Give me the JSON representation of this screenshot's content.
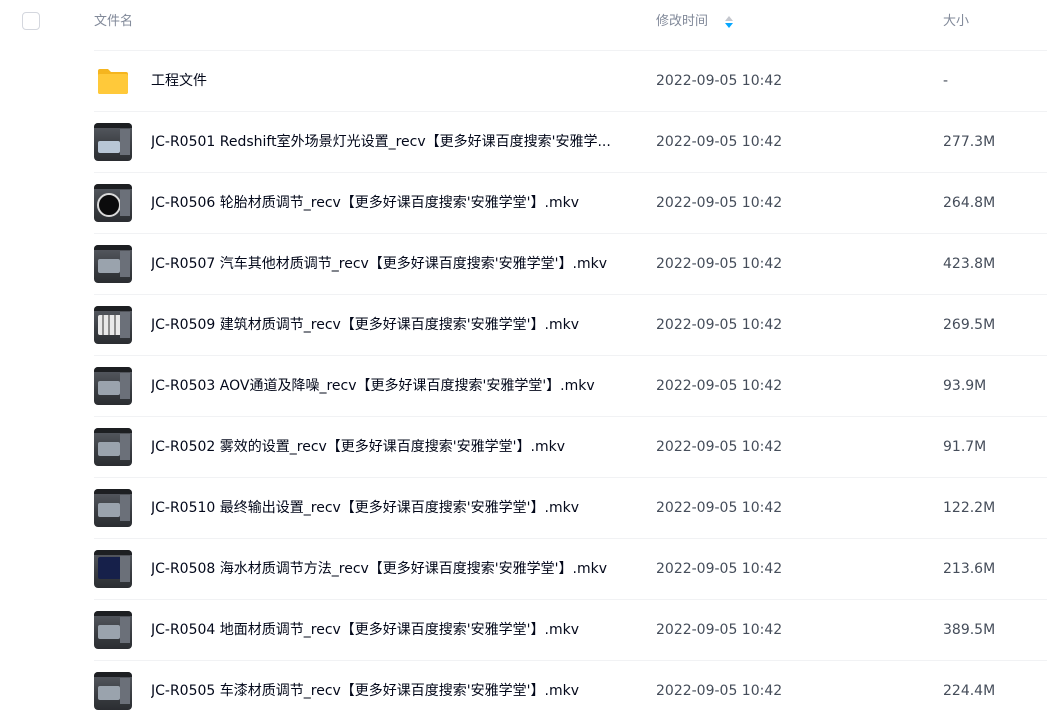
{
  "header": {
    "name_label": "文件名",
    "time_label": "修改时间",
    "size_label": "大小"
  },
  "files": [
    {
      "name": "工程文件",
      "modified": "2022-09-05 10:42",
      "size": "-",
      "icon": "folder-icon"
    },
    {
      "name": "JC-R0501 Redshift室外场景灯光设置_recv【更多好课百度搜索'安雅学...",
      "modified": "2022-09-05 10:42",
      "size": "277.3M",
      "icon": "video-thumbnail-icon"
    },
    {
      "name": "JC-R0506 轮胎材质调节_recv【更多好课百度搜索'安雅学堂'】.mkv",
      "modified": "2022-09-05 10:42",
      "size": "264.8M",
      "icon": "video-thumbnail-icon"
    },
    {
      "name": "JC-R0507 汽车其他材质调节_recv【更多好课百度搜索'安雅学堂'】.mkv",
      "modified": "2022-09-05 10:42",
      "size": "423.8M",
      "icon": "video-thumbnail-icon"
    },
    {
      "name": "JC-R0509 建筑材质调节_recv【更多好课百度搜索'安雅学堂'】.mkv",
      "modified": "2022-09-05 10:42",
      "size": "269.5M",
      "icon": "video-thumbnail-icon"
    },
    {
      "name": "JC-R0503 AOV通道及降噪_recv【更多好课百度搜索'安雅学堂'】.mkv",
      "modified": "2022-09-05 10:42",
      "size": "93.9M",
      "icon": "video-thumbnail-icon"
    },
    {
      "name": "JC-R0502 雾效的设置_recv【更多好课百度搜索'安雅学堂'】.mkv",
      "modified": "2022-09-05 10:42",
      "size": "91.7M",
      "icon": "video-thumbnail-icon"
    },
    {
      "name": "JC-R0510 最终输出设置_recv【更多好课百度搜索'安雅学堂'】.mkv",
      "modified": "2022-09-05 10:42",
      "size": "122.2M",
      "icon": "video-thumbnail-icon"
    },
    {
      "name": "JC-R0508 海水材质调节方法_recv【更多好课百度搜索'安雅学堂'】.mkv",
      "modified": "2022-09-05 10:42",
      "size": "213.6M",
      "icon": "video-thumbnail-icon"
    },
    {
      "name": "JC-R0504 地面材质调节_recv【更多好课百度搜索'安雅学堂'】.mkv",
      "modified": "2022-09-05 10:42",
      "size": "389.5M",
      "icon": "video-thumbnail-icon"
    },
    {
      "name": "JC-R0505 车漆材质调节_recv【更多好课百度搜索'安雅学堂'】.mkv",
      "modified": "2022-09-05 10:42",
      "size": "224.4M",
      "icon": "video-thumbnail-icon"
    }
  ],
  "colors": {
    "folder": "#ffc93a",
    "sort_active": "#06a7ff",
    "header_text": "#818999",
    "body_text": "#03081a"
  }
}
